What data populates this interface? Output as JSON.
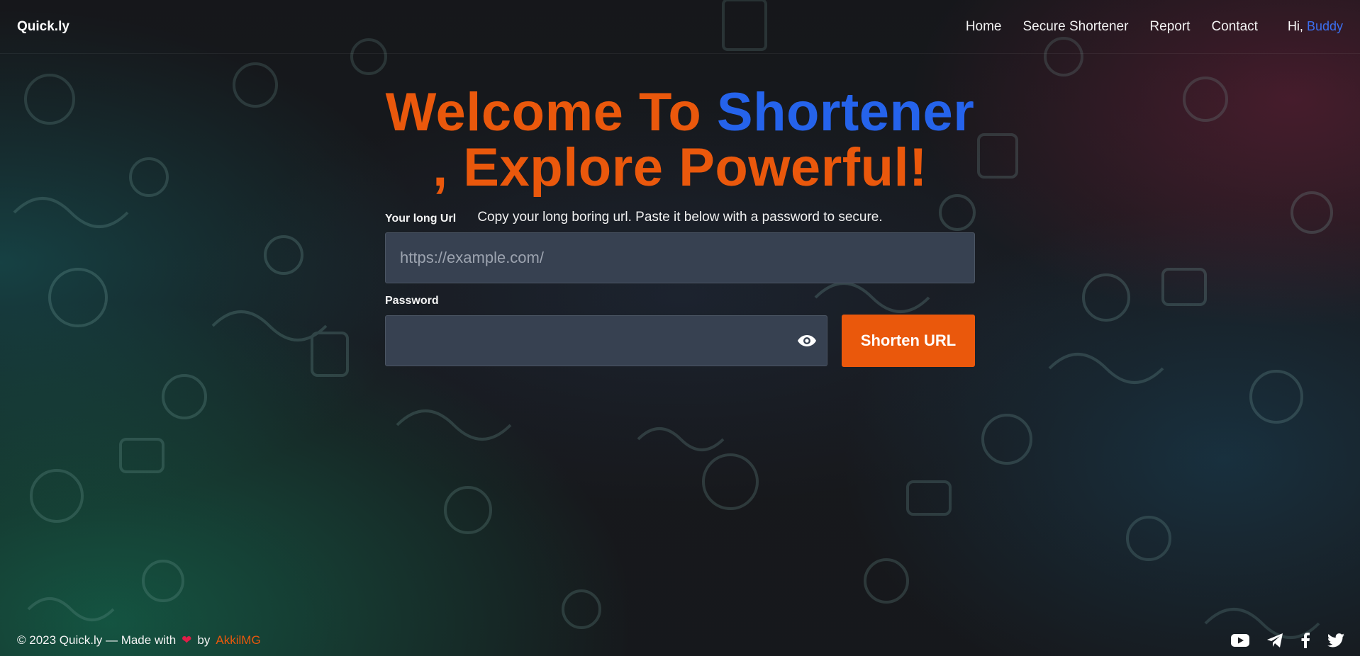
{
  "brand": "Quick.ly",
  "nav": {
    "items": [
      "Home",
      "Secure Shortener",
      "Report",
      "Contact"
    ],
    "greeting": "Hi,",
    "username": "Buddy"
  },
  "hero": {
    "title_part1": "Welcome To ",
    "title_accent": "Shortener",
    "title_part2": ", Explore Powerful!",
    "subtitle": "Copy your long boring url. Paste it below with a password to secure."
  },
  "form": {
    "url_label": "Your long Url",
    "url_placeholder": "https://example.com/",
    "url_value": "",
    "password_label": "Password",
    "password_value": "",
    "submit_label": "Shorten URL"
  },
  "footer": {
    "copyright": "© 2023 Quick.ly — Made with",
    "by": "by",
    "author": "AkkilMG",
    "social_icons": [
      "youtube-icon",
      "telegram-icon",
      "facebook-icon",
      "twitter-icon"
    ]
  },
  "colors": {
    "accent_orange": "#ea580c",
    "accent_blue": "#2563eb",
    "input_bg": "#374151"
  }
}
